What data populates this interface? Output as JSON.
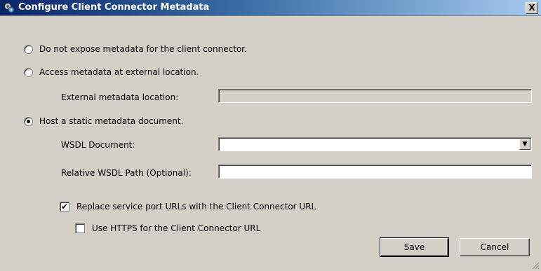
{
  "window": {
    "title": "Configure Client Connector Metadata",
    "close_label": "X",
    "icon": "connector-gear-icon"
  },
  "options": {
    "no_metadata": {
      "label": "Do not expose metadata for the client connector.",
      "checked": false
    },
    "external": {
      "label": "Access metadata at external location.",
      "checked": false
    },
    "static": {
      "label": "Host a static metadata document.",
      "checked": true
    }
  },
  "external_location": {
    "label": "External metadata location:",
    "value": ""
  },
  "wsdl_document": {
    "label": "WSDL Document:",
    "value": ""
  },
  "relative_path": {
    "label": "Relative WSDL Path (Optional):",
    "value": ""
  },
  "replace_urls": {
    "label": "Replace service port URLs with the Client Connector URL",
    "checked": true
  },
  "use_https": {
    "label": "Use HTTPS for the Client Connector URL",
    "checked": false
  },
  "buttons": {
    "save": "Save",
    "cancel": "Cancel"
  }
}
